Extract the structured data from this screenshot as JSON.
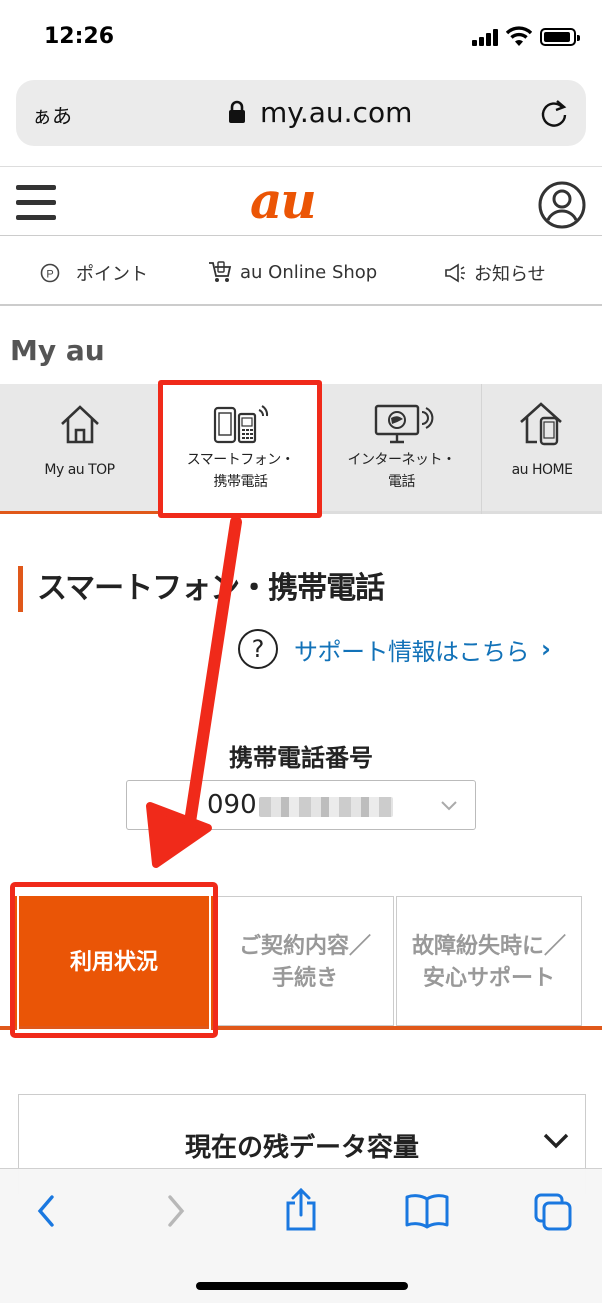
{
  "status_bar": {
    "time": "12:26"
  },
  "browser": {
    "text_size_label": "ぁあ",
    "url": "my.au.com"
  },
  "site_header": {
    "logo": "au"
  },
  "quick_links": [
    {
      "label": "ポイント",
      "icon": "point-icon"
    },
    {
      "label": "au Online Shop",
      "icon": "cart-icon"
    },
    {
      "label": "お知らせ",
      "icon": "megaphone-icon"
    }
  ],
  "myau": {
    "title": "My au"
  },
  "category_tabs": [
    {
      "label": "My au TOP",
      "icon": "home-icon",
      "active": false
    },
    {
      "label_line1": "スマートフォン・",
      "label_line2": "携帯電話",
      "icon": "smartphone-icon",
      "active": true
    },
    {
      "label_line1": "インターネット・",
      "label_line2": "電話",
      "icon": "monitor-icon",
      "active": false
    },
    {
      "label": "au HOME",
      "icon": "smart-home-icon",
      "active": false
    }
  ],
  "section": {
    "title": "スマートフォン・携帯電話",
    "support_link": "サポート情報はこちら",
    "phone_label": "携帯電話番号",
    "phone_number_prefix": "090"
  },
  "content_tabs": [
    {
      "line1": "利用状況",
      "line2": "",
      "active": true
    },
    {
      "line1": "ご契約内容／",
      "line2": "手続き",
      "active": false
    },
    {
      "line1": "故障紛失時に／",
      "line2": "安心サポート",
      "active": false
    }
  ],
  "data_card": {
    "title": "現在の残データ容量"
  },
  "toolbar": [
    "back-icon",
    "forward-icon",
    "share-icon",
    "bookmarks-icon",
    "tabs-icon"
  ],
  "colors": {
    "accent": "#ea5506",
    "link": "#1272b8",
    "highlight": "#f02a1a"
  }
}
